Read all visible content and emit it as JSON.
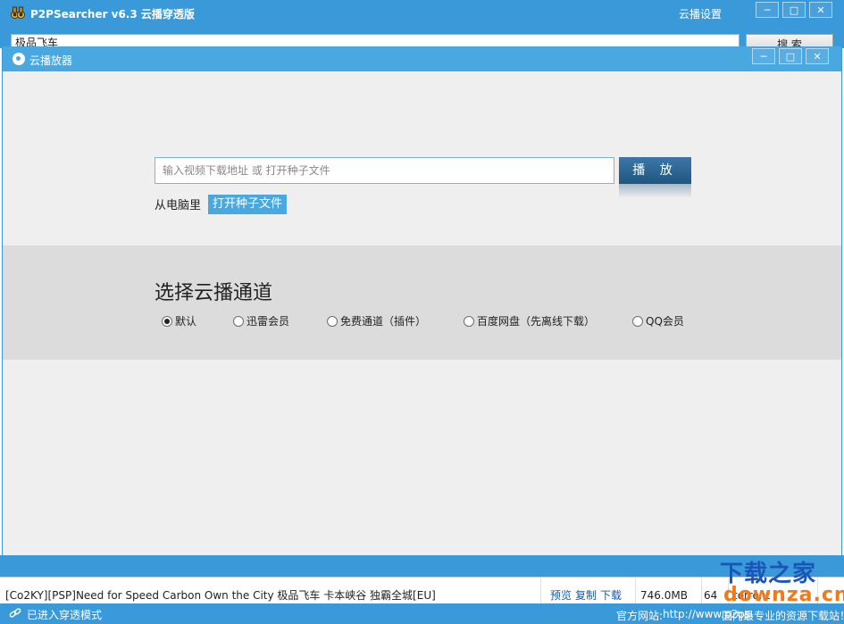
{
  "main": {
    "title": "P2PSearcher v6.3 云播穿透版",
    "settings_label": "云播设置",
    "search_value": "极品飞车",
    "search_button": "搜 索",
    "minimize": "─",
    "maximize": "□",
    "close": "✕"
  },
  "dialog": {
    "title": "云播放器",
    "url_placeholder": "输入视频下载地址 或 打开种子文件",
    "play_button": "播 放",
    "from_pc_label": "从电脑里",
    "open_torrent_button": "打开种子文件",
    "channel_heading": "选择云播通道",
    "channels": [
      {
        "label": "默认",
        "selected": true
      },
      {
        "label": "迅雷会员",
        "selected": false
      },
      {
        "label": "免费通道（插件）",
        "selected": false
      },
      {
        "label": "百度网盘（先离线下载）",
        "selected": false
      },
      {
        "label": "QQ会员",
        "selected": false
      }
    ]
  },
  "results": [
    {
      "name": "[Co2KY][PSP]Need for Speed Carbon Own the City 极品飞车 卡本峡谷 独霸全城[EU]",
      "actions": [
        "预览",
        "复制",
        "下载"
      ],
      "size": "746.0MB",
      "count": "64",
      "type": "torrent"
    }
  ],
  "statusbar": {
    "status_text": "已进入穿透模式",
    "site_label": "官方网站:",
    "site_url": "http://www.p2psearcher.cn",
    "tagline": "国内最专业的资源下载站！"
  },
  "watermark": {
    "line1": "下载之家",
    "line2": "downza.cn"
  },
  "colors": {
    "title_blue": "#3a9ad9",
    "dialog_blue": "#4aa8e0",
    "play_button": "#1f5680"
  }
}
